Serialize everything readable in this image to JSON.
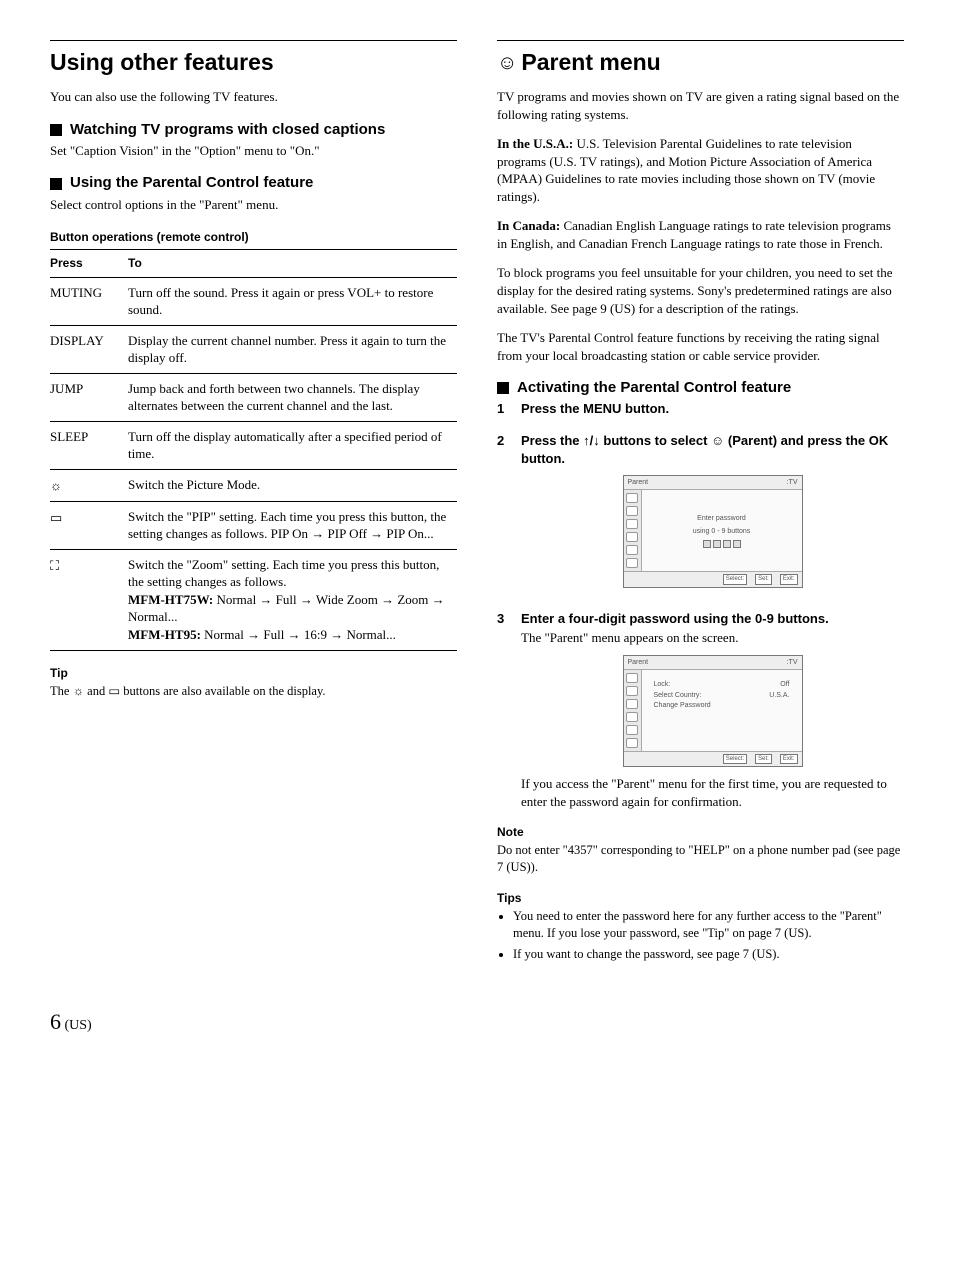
{
  "left": {
    "h1": "Using other features",
    "intro": "You can also use the following TV features.",
    "sub1": "Watching TV programs with closed captions",
    "sub1_text": "Set \"Caption Vision\" in the \"Option\" menu to \"On.\"",
    "sub2": "Using the Parental Control feature",
    "sub2_text": "Select control options in the \"Parent\" menu.",
    "table_title": "Button operations (remote control)",
    "th1": "Press",
    "th2": "To",
    "rows": {
      "r0": {
        "press": "MUTING",
        "to": "Turn off the sound. Press it again or press VOL+ to restore sound."
      },
      "r1": {
        "press": "DISPLAY",
        "to": "Display the current channel number. Press it again to turn the display off."
      },
      "r2": {
        "press": "JUMP",
        "to": "Jump back and forth between two channels. The display alternates between the current channel and the last."
      },
      "r3": {
        "press": "SLEEP",
        "to": "Turn off the display automatically after a specified period of time."
      },
      "r4": {
        "press": "☼",
        "to": "Switch the Picture Mode."
      },
      "r5": {
        "press": "▭",
        "to": "Switch the \"PIP\" setting. Each time you press this button, the setting changes as follows. PIP On → PIP Off → PIP On..."
      },
      "r6": {
        "press": "⛶",
        "to_pre": "Switch the \"Zoom\" setting. Each time you press this button, the setting changes as follows.",
        "b1": "MFM-HT75W:",
        "seq1": " Normal → Full → Wide Zoom → Zoom → Normal...",
        "b2": "MFM-HT95:",
        "seq2": " Normal → Full → 16:9 → Normal..."
      }
    },
    "tip_h": "Tip",
    "tip_body_a": "The ",
    "tip_icon1": "☼",
    "tip_body_b": " and ",
    "tip_icon2": "▭",
    "tip_body_c": " buttons are also available on the display."
  },
  "right": {
    "h1_icon": "☺",
    "h1": "Parent menu",
    "p1": "TV programs and movies shown on TV are given a rating signal based on the following rating systems.",
    "p2a": "In the U.S.A.:",
    "p2b": " U.S. Television Parental Guidelines to rate television programs (U.S. TV ratings), and Motion Picture Association of America (MPAA) Guidelines to rate movies including those shown on TV (movie ratings).",
    "p3a": "In Canada:",
    "p3b": " Canadian English Language ratings to rate television programs in English, and Canadian French Language ratings to rate those in French.",
    "p4": "To block programs you feel unsuitable for your children, you need to set the display for the desired rating systems. Sony's predetermined ratings are also available. See page 9 (US) for a description of the ratings.",
    "p5": "The TV's Parental Control feature functions by receiving the rating signal from your local broadcasting station or cable service provider.",
    "sub3": "Activating the Parental Control feature",
    "step1": "Press the MENU button.",
    "step2a": "Press the ",
    "step2_icon1": "↑/↓",
    "step2b": " buttons to select ",
    "step2_icon2": "☺",
    "step2c": " (Parent) and press the OK button.",
    "ss1": {
      "title": "Parent",
      "src": ":TV",
      "msg1": "Enter password",
      "msg2": "using 0 - 9 buttons",
      "b_sel": "Select:",
      "b_set": "Set:",
      "b_exit": "Exit:"
    },
    "step3": "Enter a four-digit password using the 0-9 buttons.",
    "step3_body": "The \"Parent\" menu appears on the screen.",
    "ss2": {
      "title": "Parent",
      "src": ":TV",
      "r1a": "Lock:",
      "r1b": "Off",
      "r2a": "Select Country:",
      "r2b": "U.S.A.",
      "r3a": "Change Password",
      "r3b": "",
      "b_sel": "Select:",
      "b_set": "Set:",
      "b_exit": "Exit:"
    },
    "step3_after": "If you access the \"Parent\" menu for the first time, you are requested to enter the password again for confirmation.",
    "note_h": "Note",
    "note_body": "Do not enter \"4357\" corresponding to \"HELP\" on a phone number pad (see page 7 (US)).",
    "tips_h": "Tips",
    "tip1": "You need to enter the password here for any further access to the \"Parent\" menu. If you lose your password, see \"Tip\" on page 7 (US).",
    "tip2": "If you want to change the password, see page 7 (US)."
  },
  "footer": {
    "num": "6",
    "reg": " (US)"
  }
}
